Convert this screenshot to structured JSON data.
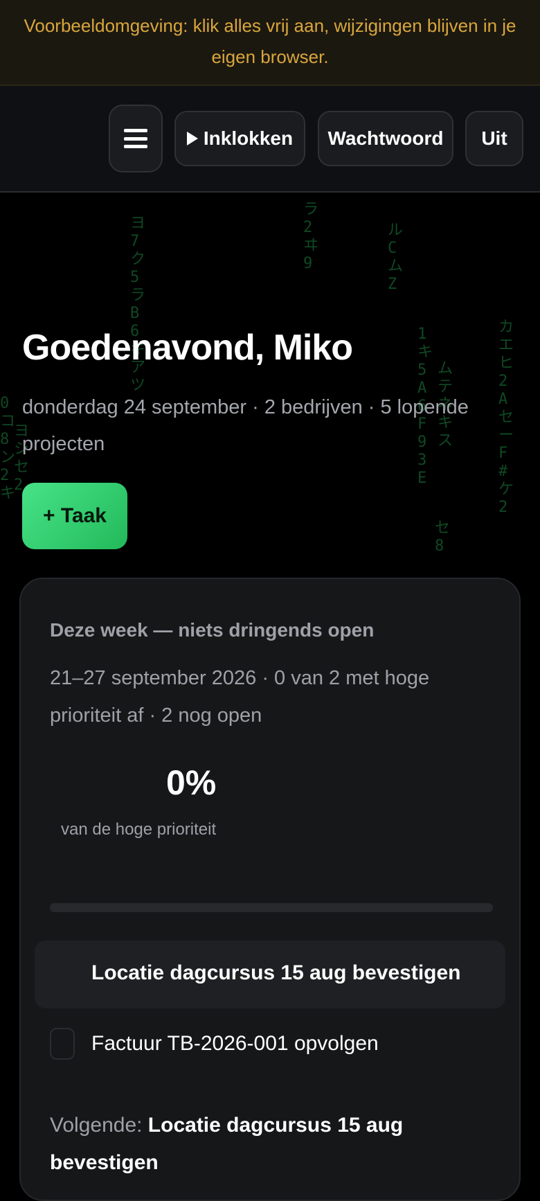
{
  "banner": {
    "text": "Voorbeeldomgeving: klik alles vrij aan, wijzigingen blijven in je eigen browser."
  },
  "toolbar": {
    "clock_in": "Inklokken",
    "password": "Wachtwoord",
    "logout": "Uit",
    "menu_icon": "hamburger-icon",
    "play_icon": "play-icon"
  },
  "hero": {
    "greeting": "Goedenavond, Miko",
    "subtitle": "donderdag 24 september · 2 bedrijven · 5 lopende projecten",
    "add_task": "+ Taak"
  },
  "week": {
    "title": "Deze week — niets dringends open",
    "meta": "21–27 september 2026 · 0 van 2 met hoge prioriteit af · 2 nog open",
    "percent": "0%",
    "percent_label": "van de hoge prioriteit",
    "progress": 0,
    "tasks": [
      {
        "label": "Locatie dagcursus 15 aug bevestigen",
        "done": false
      },
      {
        "label": "Factuur TB-2026-001 opvolgen",
        "done": false
      }
    ],
    "next_prefix": "Volgende: ",
    "next_task": "Locatie dagcursus 15 aug bevestigen"
  },
  "colors": {
    "accent_green": "#22c55e",
    "banner_text": "#d9a63c",
    "background": "#000000"
  }
}
